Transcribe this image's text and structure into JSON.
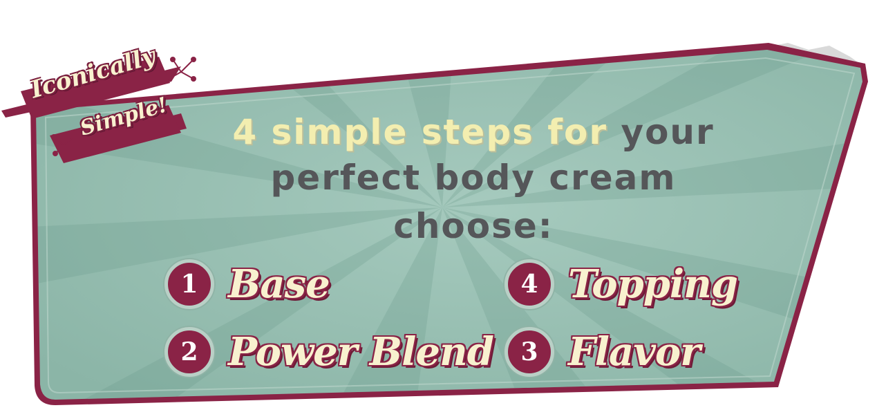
{
  "badge": {
    "line1": "Iconically",
    "line2": "Simple!"
  },
  "headline": {
    "line1_highlight": "4 Simple Steps For",
    "line1_rest": "Your",
    "line2": "Perfect Body Cream",
    "line3": "Choose:"
  },
  "steps": [
    {
      "number": "1",
      "label": "Base"
    },
    {
      "number": "4",
      "label": "Topping"
    },
    {
      "number": "2",
      "label": "Power Blend"
    },
    {
      "number": "3",
      "label": "Flavor"
    }
  ],
  "colors": {
    "panel": "#9cc3b6",
    "border": "#8a2346",
    "highlight_text": "#f3eeb0",
    "dark_text": "#555659",
    "label_text": "#f8f1cf"
  }
}
